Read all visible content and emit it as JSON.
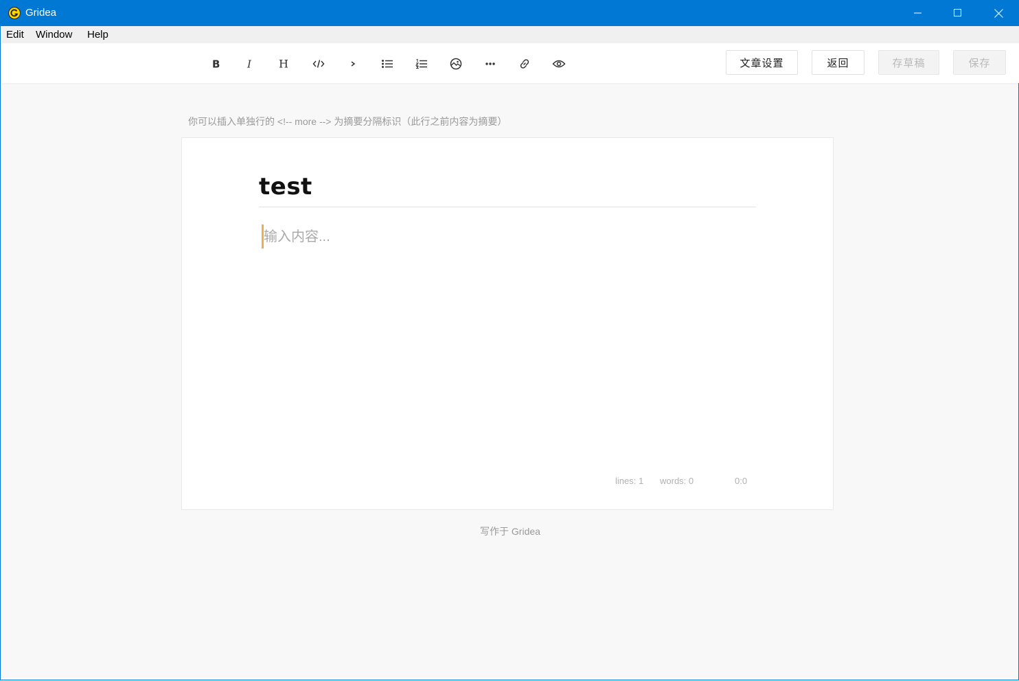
{
  "window": {
    "title": "Gridea",
    "colors": {
      "titlebar": "#0078d4",
      "cursor": "#f0ad4e"
    }
  },
  "menu": [
    "Edit",
    "Window",
    "Help"
  ],
  "toolbar": {
    "tools": [
      "bold-icon",
      "italic-icon",
      "heading-icon",
      "code-icon",
      "quote-icon",
      "bullet-list-icon",
      "numbered-list-icon",
      "image-icon",
      "more-icon",
      "link-icon",
      "preview-icon"
    ],
    "settings_label": "文章设置",
    "back_label": "返回",
    "draft_label": "存草稿",
    "save_label": "保存"
  },
  "editor": {
    "hint": "你可以插入单独行的 <!-- more --> 为摘要分隔标识（此行之前内容为摘要）",
    "title": "test",
    "content_placeholder": "输入内容...",
    "status": {
      "lines": "lines: 1",
      "words": "words: 0",
      "cursor": "0:0"
    }
  },
  "footer": "写作于 Gridea"
}
